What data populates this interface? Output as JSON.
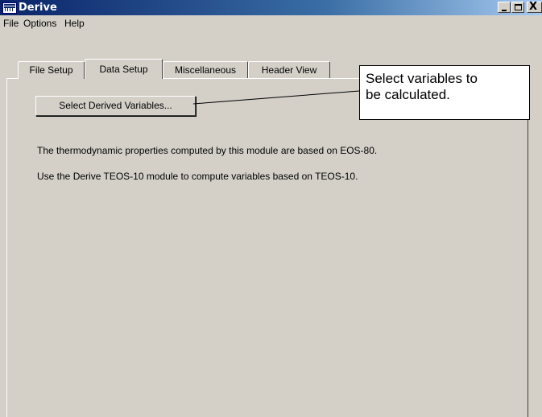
{
  "window": {
    "title": "Derive",
    "controls": {
      "minimize": "_",
      "maximize": "□",
      "close": "X"
    }
  },
  "menu": [
    "File",
    "Options",
    "Help"
  ],
  "tabs": [
    {
      "label": "File Setup",
      "selected": false
    },
    {
      "label": "Data Setup",
      "selected": true
    },
    {
      "label": "Miscellaneous",
      "selected": false
    },
    {
      "label": "Header View",
      "selected": false
    }
  ],
  "content": {
    "button_label": "Select Derived Variables...",
    "line1": "The thermodynamic properties computed by this module are based on EOS-80.",
    "line2": "Use the Derive TEOS-10 module to compute variables based on TEOS-10."
  },
  "callout": {
    "line1": "Select variables to",
    "line2": "be calculated."
  },
  "icons": {
    "app": "derive-app-icon",
    "minimize": "minimize-icon",
    "maximize": "maximize-icon",
    "close": "close-icon"
  },
  "colors": {
    "titlebar_start": "#0a246a",
    "titlebar_end": "#a6caf0",
    "face": "#d4d0c8"
  }
}
